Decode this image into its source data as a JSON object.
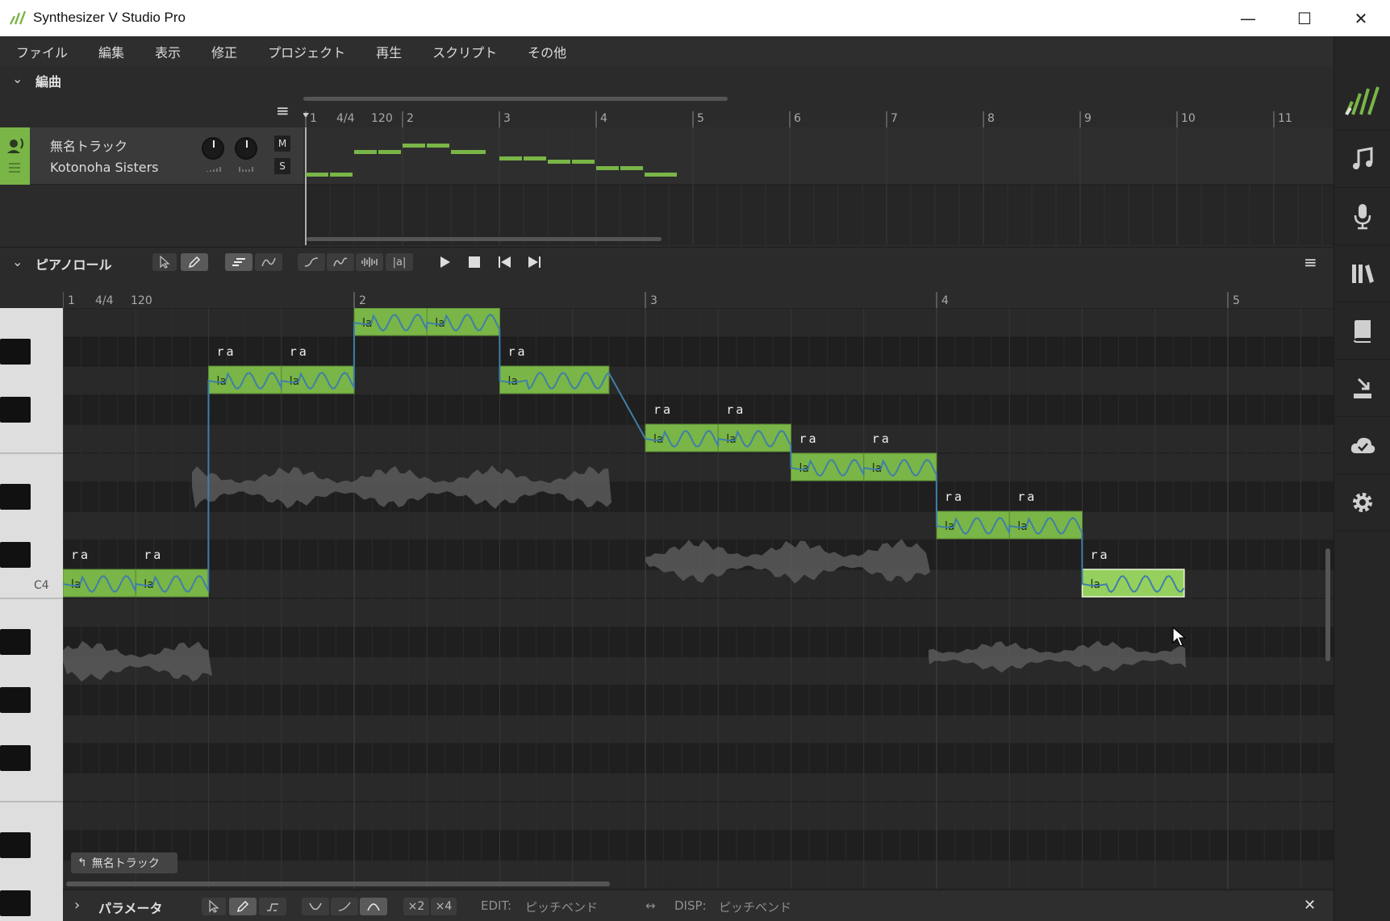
{
  "window": {
    "title": "Synthesizer V Studio Pro",
    "minimize": "—",
    "maximize": "☐",
    "close": "✕"
  },
  "menu": [
    "ファイル",
    "編集",
    "表示",
    "修正",
    "プロジェクト",
    "再生",
    "スクリプト",
    "その他"
  ],
  "arrangement": {
    "section_title": "編曲",
    "time_signature": "4/4",
    "tempo": "120",
    "bars": [
      "1",
      "2",
      "3",
      "4",
      "5",
      "6",
      "7",
      "8",
      "9",
      "10",
      "11"
    ],
    "track": {
      "name": "無名トラック",
      "voice": "Kotonoha Sisters",
      "mute_label": "M",
      "solo_label": "S"
    }
  },
  "piano_roll": {
    "section_title": "ピアノロール",
    "time_signature": "4/4",
    "tempo": "120",
    "bars": [
      "1",
      "2",
      "3",
      "4",
      "5"
    ],
    "pitch_label": "C4",
    "phoneme_button": "|a|",
    "track_tag": "無名トラック",
    "notes": [
      {
        "lyric": "la",
        "phoneme": "ra",
        "beat": 0,
        "len": 1,
        "pitch": 0
      },
      {
        "lyric": "la",
        "phoneme": "ra",
        "beat": 1,
        "len": 1,
        "pitch": 0
      },
      {
        "lyric": "la",
        "phoneme": "ra",
        "beat": 2,
        "len": 1,
        "pitch": 7
      },
      {
        "lyric": "la",
        "phoneme": "ra",
        "beat": 3,
        "len": 1,
        "pitch": 7
      },
      {
        "lyric": "la",
        "phoneme": "ra",
        "beat": 4,
        "len": 1,
        "pitch": 9
      },
      {
        "lyric": "la",
        "phoneme": "ra",
        "beat": 5,
        "len": 1,
        "pitch": 9
      },
      {
        "lyric": "la",
        "phoneme": "ra",
        "beat": 6,
        "len": 1.5,
        "pitch": 7
      },
      {
        "lyric": "la",
        "phoneme": "ra",
        "beat": 8,
        "len": 1,
        "pitch": 5
      },
      {
        "lyric": "la",
        "phoneme": "ra",
        "beat": 9,
        "len": 1,
        "pitch": 5
      },
      {
        "lyric": "la",
        "phoneme": "ra",
        "beat": 10,
        "len": 1,
        "pitch": 4
      },
      {
        "lyric": "la",
        "phoneme": "ra",
        "beat": 11,
        "len": 1,
        "pitch": 4
      },
      {
        "lyric": "la",
        "phoneme": "ra",
        "beat": 12,
        "len": 1,
        "pitch": 2
      },
      {
        "lyric": "la",
        "phoneme": "ra",
        "beat": 13,
        "len": 1,
        "pitch": 2
      },
      {
        "lyric": "la",
        "phoneme": "ra",
        "beat": 14,
        "len": 1.4,
        "pitch": 0
      }
    ]
  },
  "parameters": {
    "section_title": "パラメータ",
    "x2": "×2",
    "x4": "×4",
    "edit_label": "EDIT:",
    "edit_value": "ピッチベンド",
    "disp_label": "DISP:",
    "disp_value": "ピッチベンド",
    "close": "✕"
  },
  "colors": {
    "note_fill": "#7ab547",
    "note_selected": "#95d05e",
    "pitch_curve": "#3f7fa8",
    "accent": "#7ab547"
  },
  "sidebar_icons": [
    "logo-icon",
    "music-note-icon",
    "microphone-icon",
    "library-icon",
    "book-icon",
    "render-icon",
    "cloud-icon",
    "settings-icon"
  ]
}
